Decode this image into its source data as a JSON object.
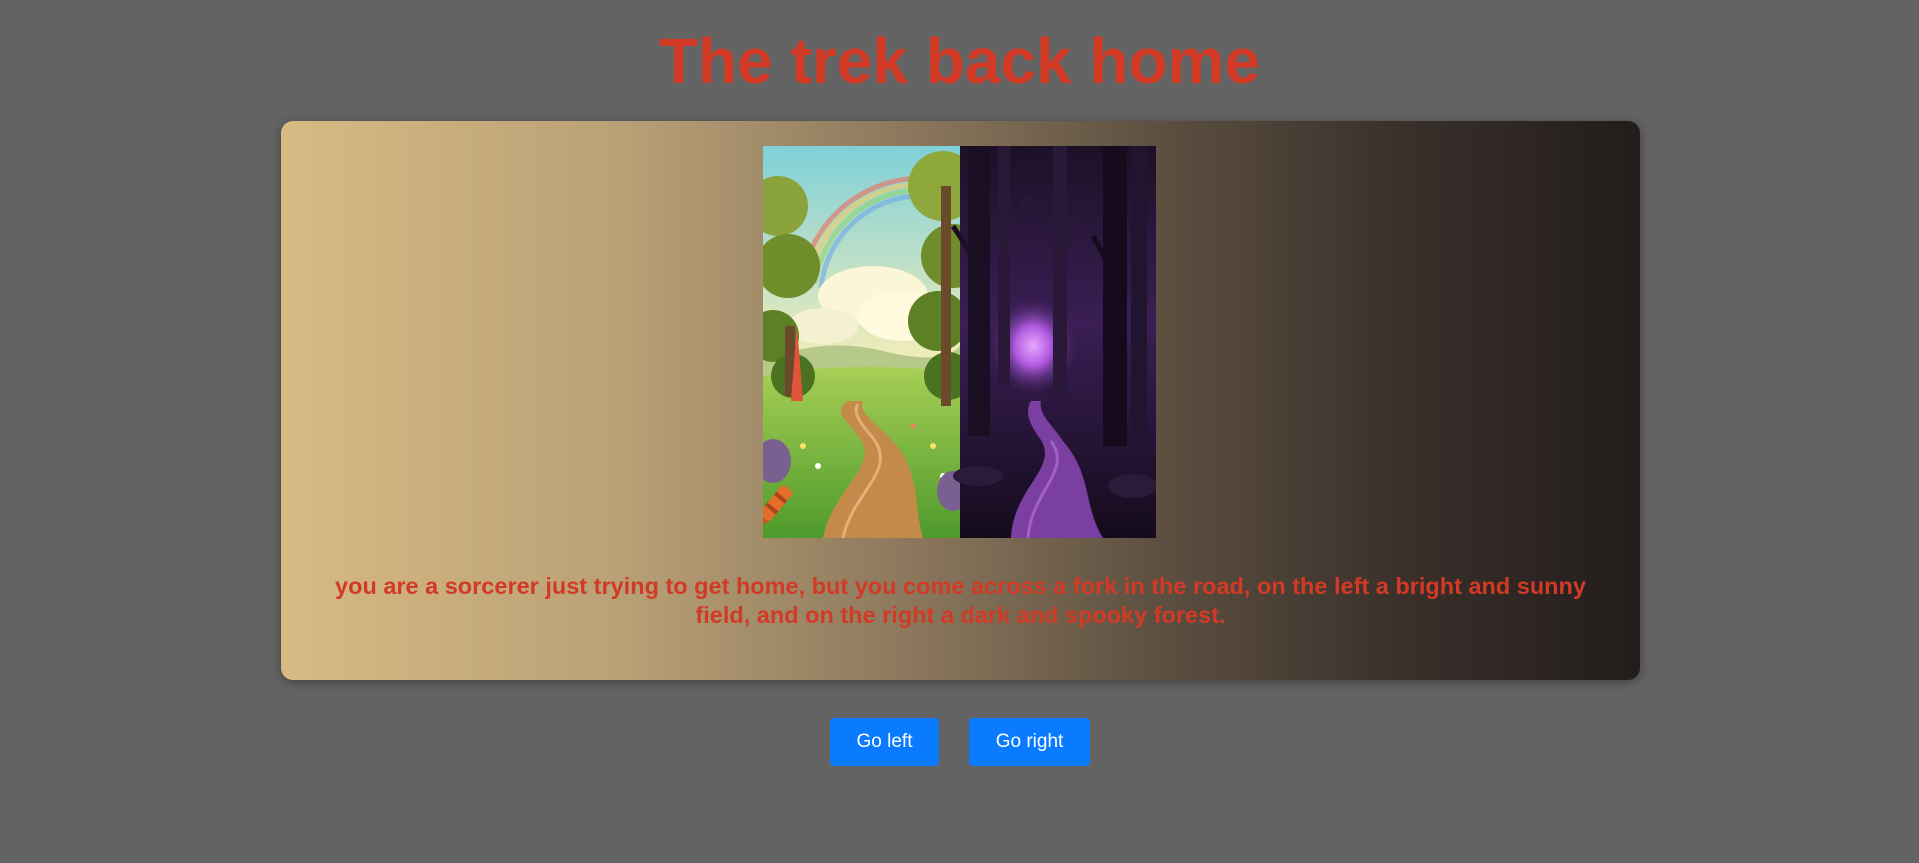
{
  "page": {
    "title": "The trek back home"
  },
  "story": {
    "text": "you are a sorcerer just trying to get home, but you come across a fork in the road, on the left a bright and sunny field, and on the right a dark and spooky forest.",
    "scene_icon": "crossroads-illustration",
    "left_half": "sunny-field-path",
    "right_half": "dark-forest-path"
  },
  "choices": {
    "left_label": "Go left",
    "right_label": "Go right"
  },
  "colors": {
    "background": "#636363",
    "title": "#d33a26",
    "story_text": "#d33a26",
    "button": "#0a7bff",
    "button_text": "#ffffff",
    "card_gradient_start": "#d8ba82",
    "card_gradient_end": "#221c1c"
  }
}
